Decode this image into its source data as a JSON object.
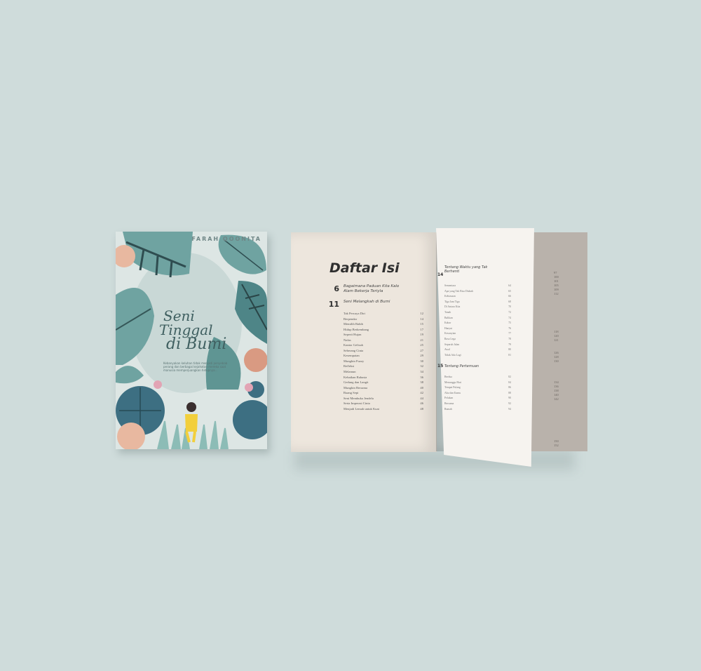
{
  "cover": {
    "author": "FARAH QOONITA",
    "title_line1": "Seni",
    "title_line2": "Tinggal",
    "title_line3": "di Bumi",
    "subtitle": "Kebanyakan keluhan tidak menjadi penyebab perang dan berbagai kejahatan mereka saat manusia memperjuangkan hidupnya..."
  },
  "toc": {
    "title": "Daftar Isi",
    "chapters": [
      {
        "num": "6",
        "title": "Bagaimana Paduan Kita Kalo Alam Bekerja Teriyla"
      },
      {
        "num": "11",
        "title": "Seni Melangkah di Bumi"
      }
    ],
    "entries": [
      {
        "label": "Tak Percaya Diri",
        "page": "12"
      },
      {
        "label": "Berpendar",
        "page": "14"
      },
      {
        "label": "Memilih Bahib",
        "page": "15"
      },
      {
        "label": "Hidup Berkembang",
        "page": "17"
      },
      {
        "label": "Seperti Hujan",
        "page": "19"
      },
      {
        "label": "Nafas",
        "page": "21"
      },
      {
        "label": "Kantor Gelisah",
        "page": "25"
      },
      {
        "label": "Seberang Cinta",
        "page": "27"
      },
      {
        "label": "Kesempatan",
        "page": "29"
      },
      {
        "label": "Mungkin Fuzzy",
        "page": "30"
      },
      {
        "label": "Refleksi",
        "page": "32"
      },
      {
        "label": "Melamun",
        "page": "34"
      },
      {
        "label": "Kebaikan Rahasia",
        "page": "36"
      },
      {
        "label": "Gedung dan Langit",
        "page": "38"
      },
      {
        "label": "Mungkin Bersama",
        "page": "40"
      },
      {
        "label": "Ruang Sepi",
        "page": "42"
      },
      {
        "label": "Seni Membuka Jendela",
        "page": "44"
      },
      {
        "label": "Serta Imperasi Cinta",
        "page": "46"
      },
      {
        "label": "Menjadi Lemah untuk Kuat",
        "page": "48"
      }
    ],
    "right_page": {
      "section_a": {
        "num": "14",
        "title": "Tentang Waktu yang Tak Berhenti"
      },
      "entries_a": [
        {
          "label": "Sementara",
          "page": "64"
        },
        {
          "label": "Apa yang Tak Bisa Diubah",
          "page": "65"
        },
        {
          "label": "Kebiasaan",
          "page": "66"
        },
        {
          "label": "Tiga Jam Tiga",
          "page": "68"
        },
        {
          "label": "Di Antara Kita",
          "page": "70"
        },
        {
          "label": "Tanah",
          "page": "72"
        },
        {
          "label": "Balikan",
          "page": "74"
        },
        {
          "label": "Kabar",
          "page": "75"
        },
        {
          "label": "Hanyut",
          "page": "76"
        },
        {
          "label": "Kesunyian",
          "page": "77"
        },
        {
          "label": "Rasa Lega",
          "page": "78"
        },
        {
          "label": "Separuh Jalan",
          "page": "79"
        },
        {
          "label": "Awal",
          "page": "80"
        },
        {
          "label": "Tidak Ada Lagi",
          "page": "81"
        }
      ],
      "section_b": {
        "num": "15",
        "title": "Tentang Pertemuan"
      },
      "entries_b": [
        {
          "label": "Berdua",
          "page": "82"
        },
        {
          "label": "Menunggu Hari",
          "page": "84"
        },
        {
          "label": "Tempat Pulang",
          "page": "86"
        },
        {
          "label": "Aku dan Kamu",
          "page": "88"
        },
        {
          "label": "Pelukan",
          "page": "90"
        },
        {
          "label": "Bersama",
          "page": "92"
        },
        {
          "label": "Rumah",
          "page": "94"
        }
      ]
    },
    "back_page_numbers": [
      "97",
      "100",
      "101",
      "105",
      "109",
      "112",
      "",
      "",
      "",
      "",
      "",
      "",
      "",
      "",
      "118",
      "120",
      "121",
      "",
      "",
      "126",
      "128",
      "130",
      "",
      "",
      "",
      "",
      "134",
      "136",
      "138",
      "140",
      "142",
      "",
      "",
      "",
      "",
      "",
      "",
      "",
      "",
      "",
      "150",
      "152"
    ]
  }
}
